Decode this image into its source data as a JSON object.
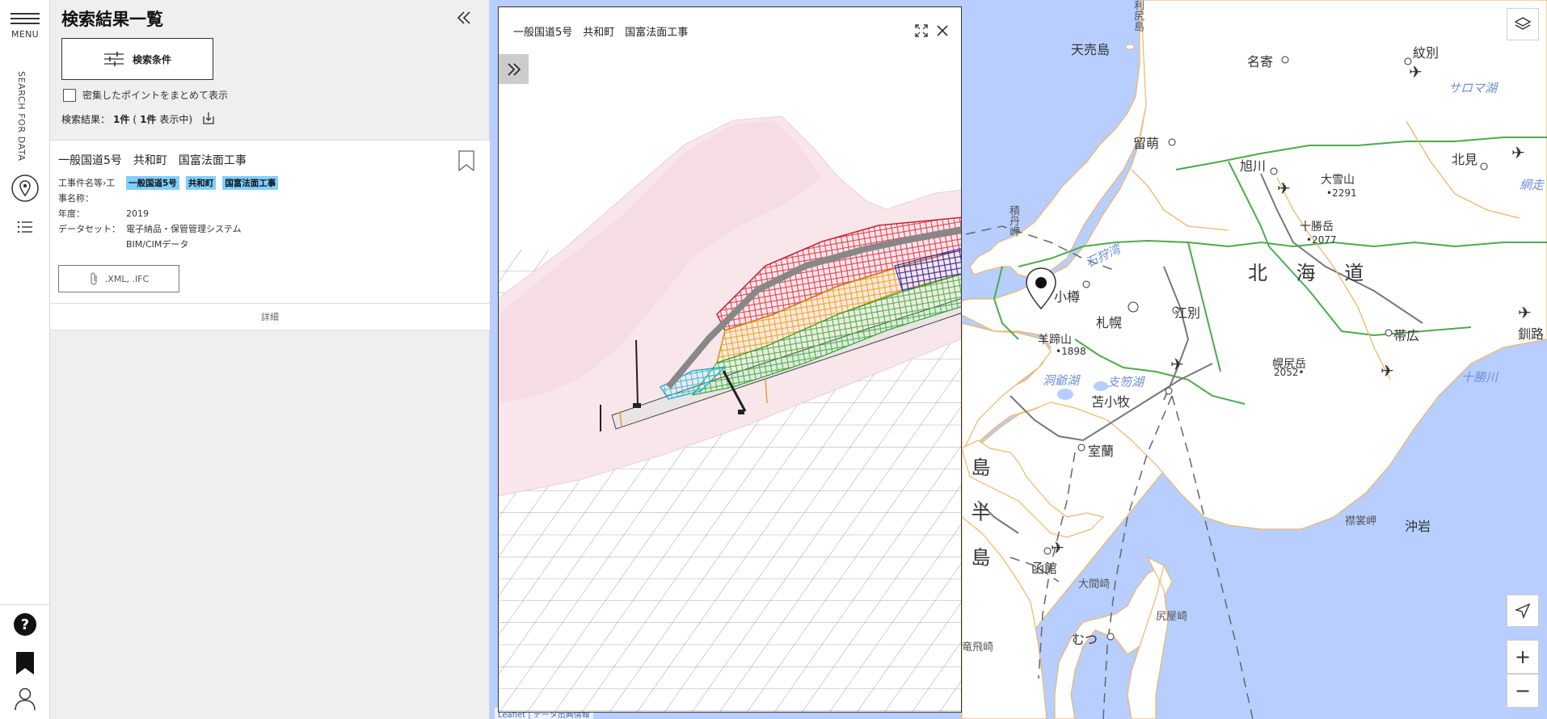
{
  "rail": {
    "menu_label": "MENU",
    "vertical_label": "SEARCH FOR DATA",
    "icons": [
      "map-pin-icon",
      "list-icon",
      "help-icon",
      "bookmark-icon",
      "user-icon"
    ]
  },
  "panel": {
    "title": "検索結果一覧",
    "search_conditions_label": "検索条件",
    "cluster_label": "密集したポイントをまとめて表示",
    "result_prefix": "検索結果：",
    "result_count": "1件",
    "result_paren": "(",
    "result_shown": "1件",
    "result_suffix": " 表示中)"
  },
  "result": {
    "title": "一般国道5号　共和町　国富法面工事",
    "name_key": "工事件名等›工",
    "name_key2": "事名称：",
    "tags": [
      "一般国道5号",
      "共和町",
      "国富法面工事"
    ],
    "year_key": "年度：",
    "year_value": "2019",
    "dataset_key": "データセット：",
    "dataset_value1": "電子納品・保管管理システム",
    "dataset_value2": "BIM/CIMデータ",
    "file_label": ".XML, .IFC",
    "detail_label": "詳細"
  },
  "viewer": {
    "title": "一般国道5号　共和町　国富法面工事"
  },
  "map": {
    "labels": {
      "rishiri": "利尻島",
      "teuri": "天売島",
      "nayoro": "名寄",
      "monbetsu": "紋別",
      "saroma": "サロマ湖",
      "rumoi": "留萌",
      "asahikawa": "旭川",
      "kitami": "北見",
      "daisetsu": "大雪山",
      "daisetsu_h": "•2291",
      "tokachi": "十勝岳",
      "tokachi_h": "•2077",
      "hokkaido": "北 海 道",
      "shakotan": "積丹岬",
      "ishikari": "石狩湾",
      "otaru": "小樽",
      "sapporo": "札幌",
      "ebetsu": "江別",
      "obihiro": "帯広",
      "kushiro": "釧路",
      "yotei": "羊蹄山",
      "yotei_h": "•1898",
      "poroshiri": "幌尻岳",
      "poroshiri_h": "2052•",
      "toya": "洞爺湖",
      "shikotsu": "支笏湖",
      "tomakomai": "苫小牧",
      "tokachi_r": "十勝川",
      "muroran": "室蘭",
      "oshima": "島 半 島",
      "hakodate": "函館",
      "erimo": "襟裳岬",
      "okiiwa": "沖岩",
      "oma": "大間崎",
      "shiriya": "尻屋崎",
      "mutsu": "むつ",
      "tappi": "竜飛崎",
      "abashiri": "網走"
    },
    "attribution": "Leaflet | データ出典情報"
  }
}
